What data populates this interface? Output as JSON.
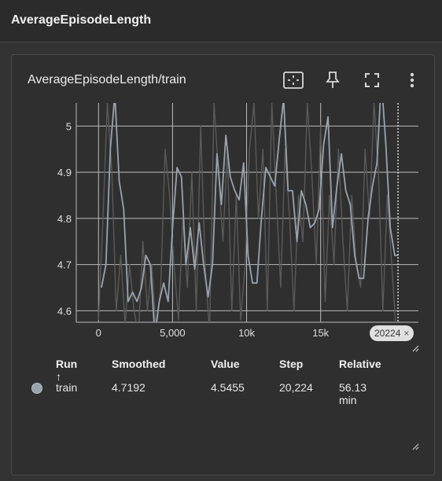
{
  "header": {
    "title": "AverageEpisodeLength"
  },
  "card": {
    "title": "AverageEpisodeLength/train",
    "icons": [
      "fit-domain-icon",
      "pin-icon",
      "fullscreen-icon",
      "more-vert-icon"
    ]
  },
  "step_badge": {
    "value": "20224",
    "close": "×"
  },
  "table": {
    "headers": {
      "run": "Run ↑",
      "smoothed": "Smoothed",
      "value": "Value",
      "step": "Step",
      "relative": "Relative"
    },
    "rows": [
      {
        "run": "train",
        "smoothed": "4.7192",
        "value": "4.5455",
        "step": "20,224",
        "relative": "56.13 min",
        "color": "#9aa3ad"
      }
    ]
  },
  "chart_data": {
    "type": "line",
    "x_ticks": [
      "0",
      "5,000",
      "10k",
      "15k"
    ],
    "x_tick_values": [
      0,
      5000,
      10000,
      15000
    ],
    "y_ticks": [
      "4.6",
      "4.7",
      "4.8",
      "4.9",
      "5"
    ],
    "y_tick_values": [
      4.6,
      4.7,
      4.8,
      4.9,
      5.0
    ],
    "xlim": [
      -1500,
      21600
    ],
    "ylim": [
      4.575,
      5.05
    ],
    "grid": true,
    "cursor_step": 20224,
    "colors": {
      "raw": "#5a5a5a",
      "smoothed": "#9aa3ad",
      "grid": "#bdbdbd"
    },
    "series": [
      {
        "role": "raw",
        "x": [
          0,
          300,
          600,
          900,
          1200,
          1500,
          1800,
          2100,
          2400,
          2700,
          3000,
          3300,
          3600,
          3900,
          4200,
          4500,
          4800,
          5100,
          5400,
          5700,
          6000,
          6300,
          6600,
          6900,
          7200,
          7500,
          7800,
          8100,
          8400,
          8700,
          9000,
          9300,
          9600,
          9900,
          10200,
          10500,
          10800,
          11100,
          11400,
          11700,
          12000,
          12300,
          12600,
          12900,
          13200,
          13500,
          13800,
          14100,
          14400,
          14700,
          15000,
          15300,
          15600,
          15900,
          16200,
          16500,
          16800,
          17100,
          17400,
          17700,
          18000,
          18300,
          18600,
          18900,
          19200,
          19500,
          19800,
          20100
        ],
        "values": [
          4.58,
          4.8,
          5.05,
          4.9,
          4.6,
          4.72,
          4.57,
          4.7,
          4.6,
          4.55,
          4.75,
          4.6,
          4.7,
          4.55,
          4.65,
          4.95,
          4.85,
          4.7,
          4.58,
          4.8,
          4.65,
          4.9,
          4.6,
          5.0,
          4.7,
          4.55,
          5.05,
          4.9,
          4.75,
          4.95,
          4.6,
          4.85,
          4.58,
          4.7,
          4.95,
          5.05,
          4.8,
          4.95,
          4.6,
          5.05,
          4.85,
          4.65,
          4.95,
          4.8,
          4.6,
          4.85,
          4.75,
          5.05,
          4.9,
          4.7,
          5.0,
          4.62,
          4.85,
          4.7,
          4.95,
          4.75,
          4.6,
          4.85,
          4.7,
          4.65,
          4.95,
          4.8,
          5.05,
          4.9,
          4.6,
          4.85,
          4.7,
          4.55
        ]
      },
      {
        "role": "smoothed",
        "x": [
          200,
          500,
          800,
          1100,
          1400,
          1700,
          2000,
          2300,
          2600,
          2900,
          3200,
          3500,
          3800,
          4100,
          4400,
          4700,
          5000,
          5300,
          5600,
          5900,
          6200,
          6500,
          6800,
          7100,
          7400,
          7700,
          8000,
          8300,
          8600,
          8900,
          9200,
          9500,
          9800,
          10100,
          10400,
          10700,
          11000,
          11300,
          11600,
          11900,
          12200,
          12500,
          12800,
          13100,
          13400,
          13700,
          14000,
          14300,
          14600,
          14900,
          15200,
          15500,
          15800,
          16100,
          16400,
          16700,
          17000,
          17300,
          17600,
          17900,
          18200,
          18500,
          18800,
          19100,
          19400,
          19700,
          20000,
          20224
        ],
        "values": [
          4.65,
          4.7,
          4.95,
          5.07,
          4.88,
          4.82,
          4.62,
          4.64,
          4.62,
          4.65,
          4.72,
          4.7,
          4.55,
          4.62,
          4.66,
          4.62,
          4.78,
          4.91,
          4.89,
          4.7,
          4.78,
          4.69,
          4.79,
          4.7,
          4.63,
          4.7,
          4.94,
          4.83,
          4.98,
          4.89,
          4.86,
          4.84,
          4.92,
          4.72,
          4.66,
          4.66,
          4.8,
          4.91,
          4.89,
          4.87,
          4.97,
          5.06,
          4.86,
          4.86,
          4.75,
          4.86,
          4.83,
          4.78,
          4.79,
          4.82,
          4.96,
          5.02,
          4.78,
          4.87,
          4.94,
          4.86,
          4.83,
          4.72,
          4.67,
          4.67,
          4.8,
          4.87,
          4.92,
          5.1,
          4.96,
          4.78,
          4.72,
          4.72
        ]
      }
    ]
  }
}
